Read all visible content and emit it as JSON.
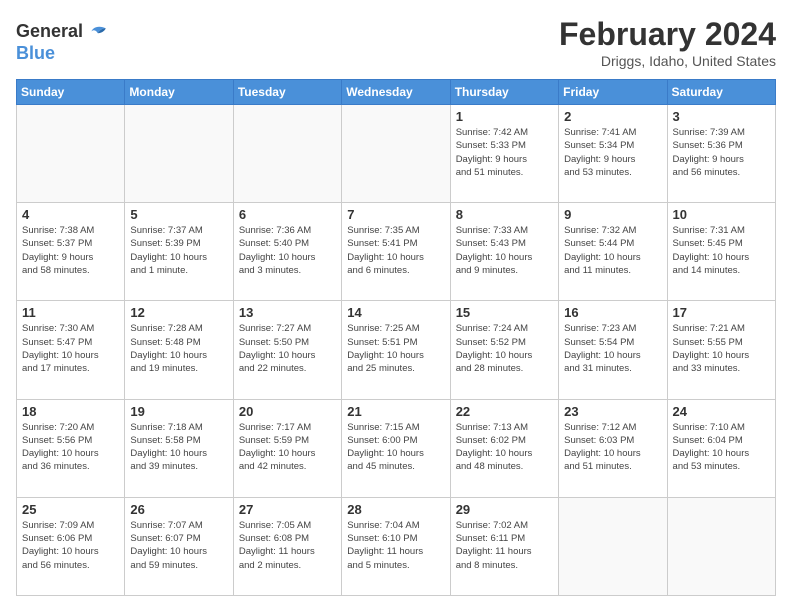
{
  "header": {
    "logo_line1": "General",
    "logo_line2": "Blue",
    "month": "February 2024",
    "location": "Driggs, Idaho, United States"
  },
  "days_of_week": [
    "Sunday",
    "Monday",
    "Tuesday",
    "Wednesday",
    "Thursday",
    "Friday",
    "Saturday"
  ],
  "weeks": [
    [
      {
        "day": "",
        "info": ""
      },
      {
        "day": "",
        "info": ""
      },
      {
        "day": "",
        "info": ""
      },
      {
        "day": "",
        "info": ""
      },
      {
        "day": "1",
        "info": "Sunrise: 7:42 AM\nSunset: 5:33 PM\nDaylight: 9 hours\nand 51 minutes."
      },
      {
        "day": "2",
        "info": "Sunrise: 7:41 AM\nSunset: 5:34 PM\nDaylight: 9 hours\nand 53 minutes."
      },
      {
        "day": "3",
        "info": "Sunrise: 7:39 AM\nSunset: 5:36 PM\nDaylight: 9 hours\nand 56 minutes."
      }
    ],
    [
      {
        "day": "4",
        "info": "Sunrise: 7:38 AM\nSunset: 5:37 PM\nDaylight: 9 hours\nand 58 minutes."
      },
      {
        "day": "5",
        "info": "Sunrise: 7:37 AM\nSunset: 5:39 PM\nDaylight: 10 hours\nand 1 minute."
      },
      {
        "day": "6",
        "info": "Sunrise: 7:36 AM\nSunset: 5:40 PM\nDaylight: 10 hours\nand 3 minutes."
      },
      {
        "day": "7",
        "info": "Sunrise: 7:35 AM\nSunset: 5:41 PM\nDaylight: 10 hours\nand 6 minutes."
      },
      {
        "day": "8",
        "info": "Sunrise: 7:33 AM\nSunset: 5:43 PM\nDaylight: 10 hours\nand 9 minutes."
      },
      {
        "day": "9",
        "info": "Sunrise: 7:32 AM\nSunset: 5:44 PM\nDaylight: 10 hours\nand 11 minutes."
      },
      {
        "day": "10",
        "info": "Sunrise: 7:31 AM\nSunset: 5:45 PM\nDaylight: 10 hours\nand 14 minutes."
      }
    ],
    [
      {
        "day": "11",
        "info": "Sunrise: 7:30 AM\nSunset: 5:47 PM\nDaylight: 10 hours\nand 17 minutes."
      },
      {
        "day": "12",
        "info": "Sunrise: 7:28 AM\nSunset: 5:48 PM\nDaylight: 10 hours\nand 19 minutes."
      },
      {
        "day": "13",
        "info": "Sunrise: 7:27 AM\nSunset: 5:50 PM\nDaylight: 10 hours\nand 22 minutes."
      },
      {
        "day": "14",
        "info": "Sunrise: 7:25 AM\nSunset: 5:51 PM\nDaylight: 10 hours\nand 25 minutes."
      },
      {
        "day": "15",
        "info": "Sunrise: 7:24 AM\nSunset: 5:52 PM\nDaylight: 10 hours\nand 28 minutes."
      },
      {
        "day": "16",
        "info": "Sunrise: 7:23 AM\nSunset: 5:54 PM\nDaylight: 10 hours\nand 31 minutes."
      },
      {
        "day": "17",
        "info": "Sunrise: 7:21 AM\nSunset: 5:55 PM\nDaylight: 10 hours\nand 33 minutes."
      }
    ],
    [
      {
        "day": "18",
        "info": "Sunrise: 7:20 AM\nSunset: 5:56 PM\nDaylight: 10 hours\nand 36 minutes."
      },
      {
        "day": "19",
        "info": "Sunrise: 7:18 AM\nSunset: 5:58 PM\nDaylight: 10 hours\nand 39 minutes."
      },
      {
        "day": "20",
        "info": "Sunrise: 7:17 AM\nSunset: 5:59 PM\nDaylight: 10 hours\nand 42 minutes."
      },
      {
        "day": "21",
        "info": "Sunrise: 7:15 AM\nSunset: 6:00 PM\nDaylight: 10 hours\nand 45 minutes."
      },
      {
        "day": "22",
        "info": "Sunrise: 7:13 AM\nSunset: 6:02 PM\nDaylight: 10 hours\nand 48 minutes."
      },
      {
        "day": "23",
        "info": "Sunrise: 7:12 AM\nSunset: 6:03 PM\nDaylight: 10 hours\nand 51 minutes."
      },
      {
        "day": "24",
        "info": "Sunrise: 7:10 AM\nSunset: 6:04 PM\nDaylight: 10 hours\nand 53 minutes."
      }
    ],
    [
      {
        "day": "25",
        "info": "Sunrise: 7:09 AM\nSunset: 6:06 PM\nDaylight: 10 hours\nand 56 minutes."
      },
      {
        "day": "26",
        "info": "Sunrise: 7:07 AM\nSunset: 6:07 PM\nDaylight: 10 hours\nand 59 minutes."
      },
      {
        "day": "27",
        "info": "Sunrise: 7:05 AM\nSunset: 6:08 PM\nDaylight: 11 hours\nand 2 minutes."
      },
      {
        "day": "28",
        "info": "Sunrise: 7:04 AM\nSunset: 6:10 PM\nDaylight: 11 hours\nand 5 minutes."
      },
      {
        "day": "29",
        "info": "Sunrise: 7:02 AM\nSunset: 6:11 PM\nDaylight: 11 hours\nand 8 minutes."
      },
      {
        "day": "",
        "info": ""
      },
      {
        "day": "",
        "info": ""
      }
    ]
  ]
}
